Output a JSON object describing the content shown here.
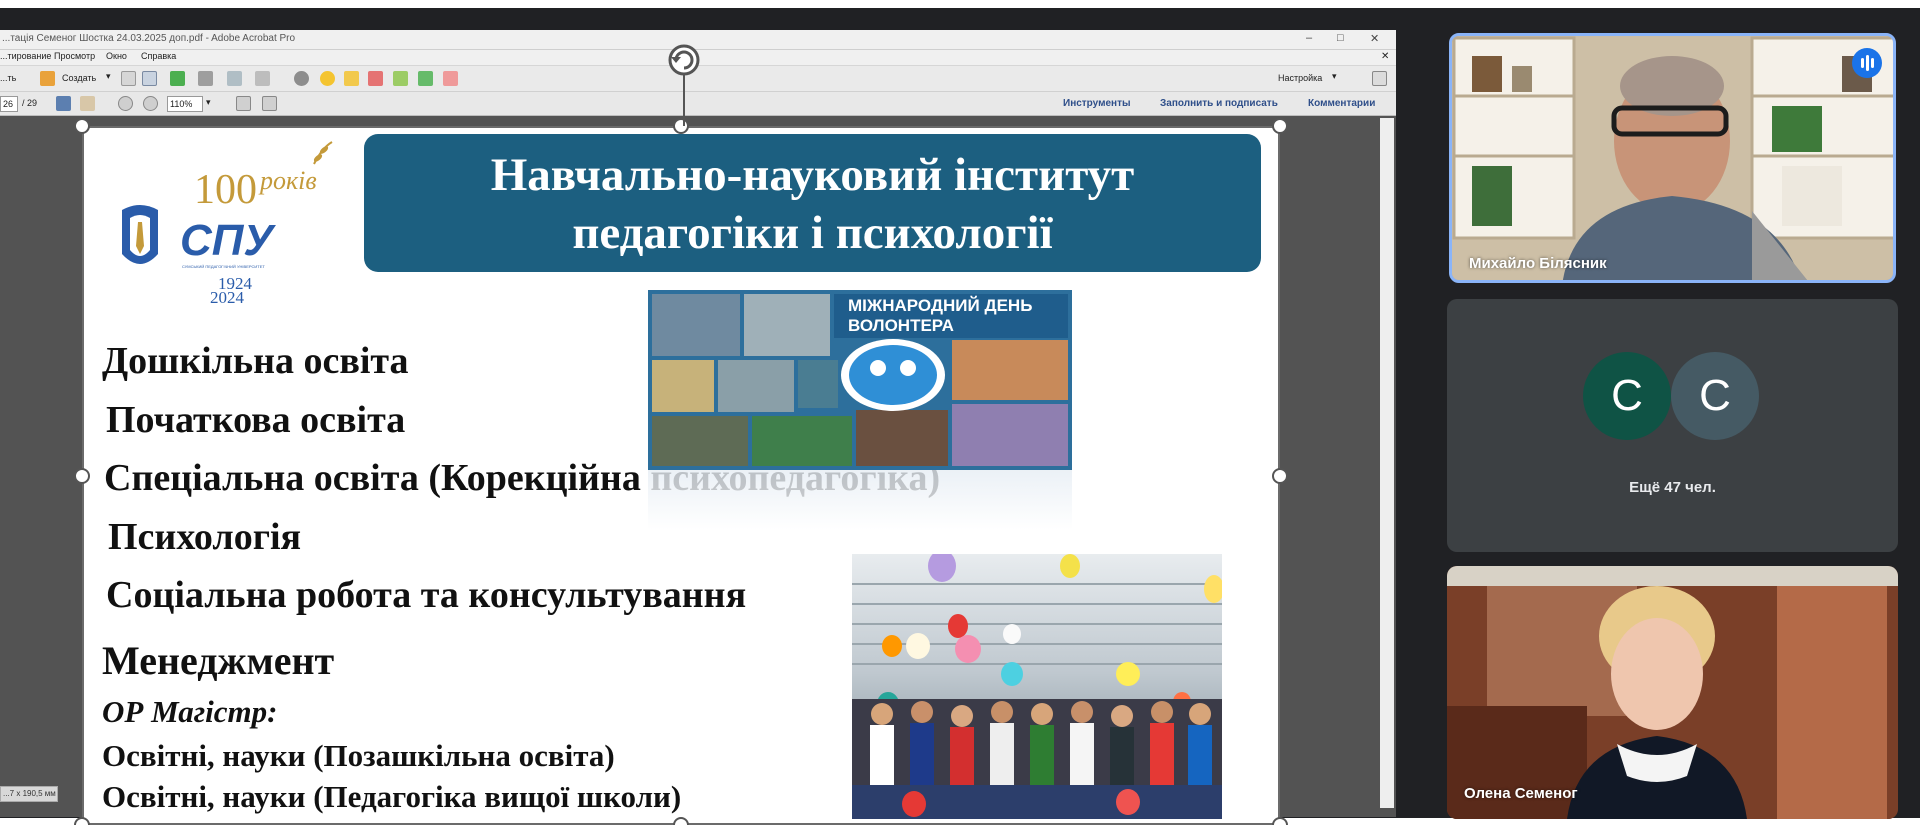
{
  "acrobat": {
    "title": "...тація Семеног Шостка 24.03.2025 доп.pdf - Adobe Acrobat Pro",
    "window_controls": {
      "minimize": "–",
      "maximize": "□",
      "close": "✕"
    },
    "menu": [
      "...тирование",
      "Просмотр",
      "Окно",
      "Справка"
    ],
    "menu_left_cut": "...ть",
    "toolbar": {
      "create_label": "Создать",
      "settings_label": "Настройка"
    },
    "nav": {
      "page_current": "26",
      "page_total": "/ 29",
      "zoom": "110%"
    },
    "panel_links": [
      "Инструменты",
      "Заполнить и подписать",
      "Комментарии"
    ],
    "status_size": "...7 x 190,5 мм"
  },
  "slide": {
    "banner": {
      "line1": "Навчально-науковий інститут",
      "line2": "педагогіки і психології"
    },
    "logo": {
      "years": "100",
      "years_word": "років",
      "abbr": "СПУ",
      "subtitle": "СУМСЬКИЙ ПЕДАГОГІЧНИЙ УНІВЕРСИТЕТ",
      "year_start": "1924",
      "year_end": "2024"
    },
    "programs": [
      "Дошкільна освіта",
      "Початкова освіта",
      "Спеціальна освіта (Корекційна психопедагогіка)",
      "Психологія",
      "Соціальна робота та консультування",
      "Менеджмент"
    ],
    "master_heading": "ОР Магістр:",
    "master_programs": [
      "Освітні, науки (Позашкільна освіта)",
      "Освітні, науки (Педагогіка вищої школи)"
    ],
    "photo1_caption_line1": "МІЖНАРОДНИЙ ДЕНЬ",
    "photo1_caption_line2": "ВОЛОНТЕРА"
  },
  "meet": {
    "tile1_name": "Михайло Білясник",
    "avatars": [
      {
        "letter": "С",
        "color": "#0f5345"
      },
      {
        "letter": "С",
        "color": "#455a64"
      }
    ],
    "more_label": "Ещё 47 чел.",
    "tile3_name": "Олена Семеног"
  }
}
